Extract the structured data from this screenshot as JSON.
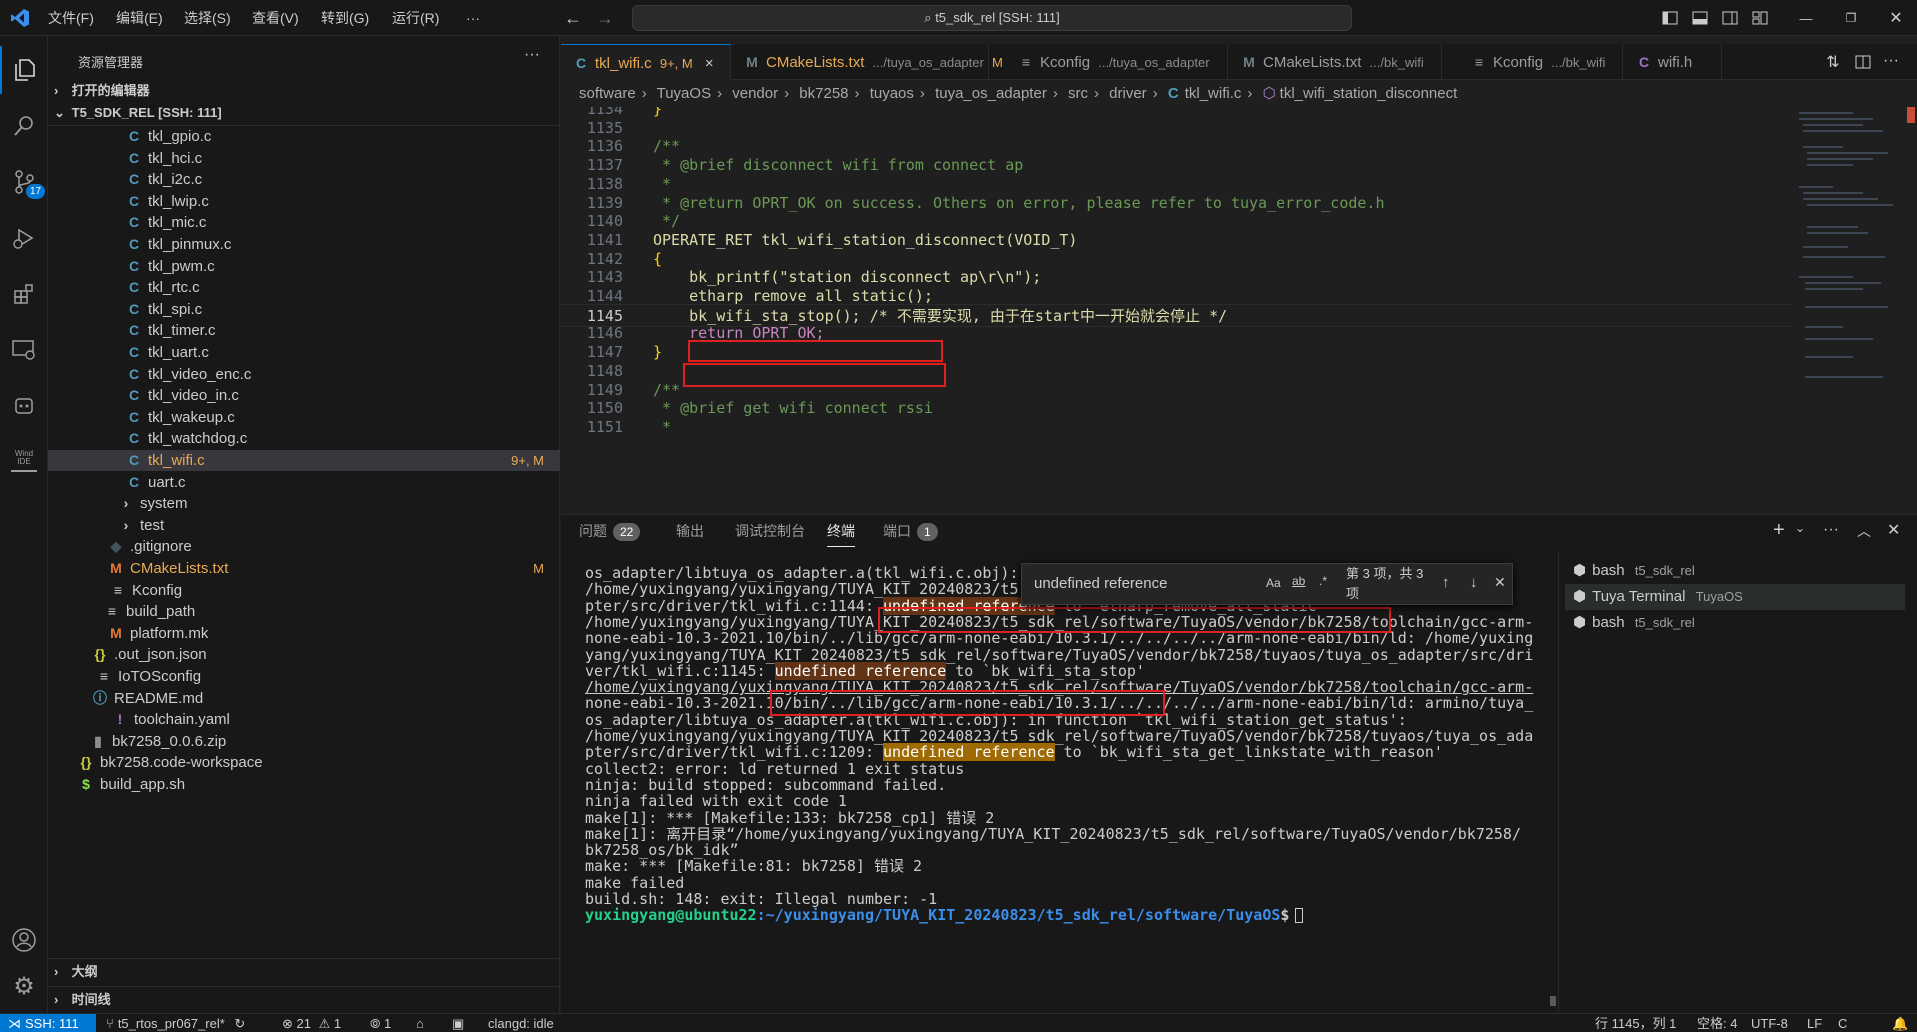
{
  "titlebar": {
    "menus": [
      "文件(F)",
      "编辑(E)",
      "选择(S)",
      "查看(V)",
      "转到(G)",
      "运行(R)",
      "···"
    ],
    "command_center": "t5_sdk_rel [SSH: 111]"
  },
  "activity": {
    "scm_badge": "17",
    "wind_ide": "Wind IDE"
  },
  "sidebar": {
    "title": "资源管理器",
    "more": "···",
    "open_editors": "打开的编辑器",
    "root": "T5_SDK_REL [SSH: 111]",
    "files": [
      {
        "name": "tkl_gpio.c",
        "icon": "C"
      },
      {
        "name": "tkl_hci.c",
        "icon": "C"
      },
      {
        "name": "tkl_i2c.c",
        "icon": "C"
      },
      {
        "name": "tkl_lwip.c",
        "icon": "C"
      },
      {
        "name": "tkl_mic.c",
        "icon": "C"
      },
      {
        "name": "tkl_pinmux.c",
        "icon": "C"
      },
      {
        "name": "tkl_pwm.c",
        "icon": "C"
      },
      {
        "name": "tkl_rtc.c",
        "icon": "C"
      },
      {
        "name": "tkl_spi.c",
        "icon": "C"
      },
      {
        "name": "tkl_timer.c",
        "icon": "C"
      },
      {
        "name": "tkl_uart.c",
        "icon": "C"
      },
      {
        "name": "tkl_video_enc.c",
        "icon": "C"
      },
      {
        "name": "tkl_video_in.c",
        "icon": "C"
      },
      {
        "name": "tkl_wakeup.c",
        "icon": "C"
      },
      {
        "name": "tkl_watchdog.c",
        "icon": "C"
      },
      {
        "name": "tkl_wifi.c",
        "icon": "C",
        "badge": "9+, M"
      },
      {
        "name": "uart.c",
        "icon": "C"
      },
      {
        "name": "system",
        "icon": "folder"
      },
      {
        "name": "test",
        "icon": "folder"
      },
      {
        "name": ".gitignore",
        "icon": "git"
      },
      {
        "name": "CMakeLists.txt",
        "icon": "M",
        "badge": "M"
      },
      {
        "name": "Kconfig",
        "icon": "lines"
      },
      {
        "name": "build_path",
        "icon": "lines"
      },
      {
        "name": "platform.mk",
        "icon": "M"
      },
      {
        "name": ".out_json.json",
        "icon": "{}"
      },
      {
        "name": "IoTOSconfig",
        "icon": "lines"
      },
      {
        "name": "README.md",
        "icon": "info"
      },
      {
        "name": "toolchain.yaml",
        "icon": "!"
      },
      {
        "name": "bk7258_0.0.6.zip",
        "icon": "zip"
      },
      {
        "name": "bk7258.code-workspace",
        "icon": "{}"
      },
      {
        "name": "build_app.sh",
        "icon": "$"
      }
    ],
    "outline": "大纲",
    "timeline": "时间线"
  },
  "tabs": [
    {
      "icon": "C",
      "name": "tkl_wifi.c",
      "suffix": "9+, M",
      "close": "×"
    },
    {
      "icon": "M",
      "name": "CMakeLists.txt",
      "path": ".../tuya_os_adapter",
      "suffix": "M"
    },
    {
      "icon": "≡",
      "name": "Kconfig",
      "path": ".../tuya_os_adapter"
    },
    {
      "icon": "M",
      "name": "CMakeLists.txt",
      "path": ".../bk_wifi"
    },
    {
      "icon": "≡",
      "name": "Kconfig",
      "path": ".../bk_wifi"
    },
    {
      "icon": "C",
      "name": "wifi.h"
    }
  ],
  "breadcrumb": [
    "software",
    "TuyaOS",
    "vendor",
    "bk7258",
    "tuyaos",
    "tuya_os_adapter",
    "src",
    "driver",
    "tkl_wifi.c",
    "tkl_wifi_station_disconnect"
  ],
  "code": {
    "line_numbers": [
      "1134",
      "1135",
      "1136",
      "1137",
      "1138",
      "1139",
      "1140",
      "1141",
      "1142",
      "1143",
      "1144",
      "1145",
      "1146",
      "1147",
      "1148",
      "1149",
      "1150",
      "1151"
    ],
    "lines": [
      "}",
      "",
      "/**",
      " * @brief disconnect wifi from connect ap",
      " *",
      " * @return OPRT_OK on success. Others on error, please refer to tuya_error_code.h",
      " */",
      "OPERATE_RET tkl_wifi_station_disconnect(VOID_T)",
      "{",
      "    bk_printf(\"station disconnect ap\\r\\n\");",
      "    etharp_remove_all_static();",
      "    bk_wifi_sta_stop(); /* 不需要实现, 由于在start中一开始就会停止 */",
      "    return OPRT_OK;",
      "}",
      "",
      "/**",
      " * @brief get wifi connect rssi",
      " *"
    ]
  },
  "panel": {
    "tabs": [
      {
        "label": "问题",
        "badge": "22"
      },
      {
        "label": "输出"
      },
      {
        "label": "调试控制台"
      },
      {
        "label": "终端"
      },
      {
        "label": "端口",
        "badge": "1"
      }
    ],
    "terminal_lines": [
      "os_adapter/libtuya_os_adapter.a(tkl_wifi.c.obj):",
      "/home/yuxingyang/yuxingyang/TUYA_KIT_20240823/t5                                   a",
      "pter/src/driver/tkl_wifi.c:1144: undefined reference to `etharp_remove_all_static'",
      "/home/yuxingyang/yuxingyang/TUYA_KIT_20240823/t5_sdk_rel/software/TuyaOS/vendor/bk7258/toolchain/gcc-arm-",
      "none-eabi-10.3-2021.10/bin/../lib/gcc/arm-none-eabi/10.3.1/../../../../arm-none-eabi/bin/ld: /home/yuxing",
      "yang/yuxingyang/TUYA_KIT_20240823/t5_sdk_rel/software/TuyaOS/vendor/bk7258/tuyaos/tuya_os_adapter/src/dri",
      "ver/tkl_wifi.c:1145: undefined reference to `bk_wifi_sta_stop'",
      "/home/yuxingyang/yuxingyang/TUYA_KIT_20240823/t5_sdk_rel/software/TuyaOS/vendor/bk7258/toolchain/gcc-arm-",
      "none-eabi-10.3-2021.10/bin/../lib/gcc/arm-none-eabi/10.3.1/../../../../arm-none-eabi/bin/ld: armino/tuya_",
      "os_adapter/libtuya_os_adapter.a(tkl_wifi.c.obj): in function `tkl_wifi_station_get_status':",
      "/home/yuxingyang/yuxingyang/TUYA_KIT_20240823/t5_sdk_rel/software/TuyaOS/vendor/bk7258/tuyaos/tuya_os_ada",
      "pter/src/driver/tkl_wifi.c:1209: undefined reference to `bk_wifi_sta_get_linkstate_with_reason'",
      "collect2: error: ld returned 1 exit status",
      "ninja: build stopped: subcommand failed.",
      "ninja failed with exit code 1",
      "make[1]: *** [Makefile:133: bk7258_cp1] 错误 2",
      "make[1]: 离开目录“/home/yuxingyang/yuxingyang/TUYA_KIT_20240823/t5_sdk_rel/software/TuyaOS/vendor/bk7258/",
      "bk7258_os/bk_idk”",
      "make: *** [Makefile:81: bk7258] 错误 2",
      "make failed",
      "build.sh: 148: exit: Illegal number: -1"
    ],
    "prompt_user": "yuxingyang@ubuntu22",
    "prompt_path": ":~/yuxingyang/TUYA_KIT_20240823/t5_sdk_rel/software/TuyaOS",
    "prompt_sym": "$",
    "find": {
      "value": "undefined reference",
      "aa": "Aa",
      "ab": "ab",
      "regex": ".*",
      "result1": "第 3 项，共 3",
      "result2": "项"
    },
    "terminals": [
      {
        "name": "bash",
        "detail": "t5_sdk_rel"
      },
      {
        "name": "Tuya Terminal",
        "detail": "TuyaOS"
      },
      {
        "name": "bash",
        "detail": "t5_sdk_rel"
      }
    ]
  },
  "statusbar": {
    "remote": "SSH: 111",
    "branch": "t5_rtos_pr067_rel*",
    "errors": "21",
    "warnings": "1",
    "ports": "1",
    "clangd": "clangd: idle",
    "position": "行 1145，列 1",
    "spaces": "空格: 4",
    "encoding": "UTF-8",
    "eol": "LF",
    "language": "C"
  },
  "colors": {
    "accent": "#0078d4",
    "find_highlight": "#9e6a03",
    "annotation_box": "#e02020",
    "prompt_green": "#23d18b",
    "prompt_blue": "#3b8eea"
  }
}
